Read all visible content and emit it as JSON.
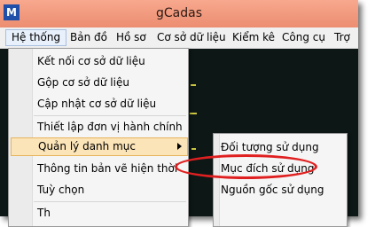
{
  "window": {
    "title": "gCadas",
    "icon_letter": "M"
  },
  "menubar": {
    "items": [
      "Hệ thống",
      "Bản đồ",
      "Hồ sơ",
      "Cơ sở dữ liệu",
      "Kiểm kê",
      "Công cụ",
      "Trợ"
    ]
  },
  "dropdown": {
    "items": [
      "Kết nối cơ sở dữ liệu",
      "Gộp cơ sở dữ liệu",
      "Cập nhật cơ sở dữ liệu",
      "Thiết lập đơn vị hành chính",
      "Quản lý danh mục",
      "Thông tin bản vẽ hiện thời",
      "Tuỳ chọn",
      "Th"
    ]
  },
  "submenu": {
    "items": [
      "Đối tượng sử dụng",
      "Mục đích sử dụng",
      "Nguồn gốc sử dụng"
    ]
  },
  "colors": {
    "highlight_ellipse": "#e02020",
    "menu_hover": "#fbe4b8"
  }
}
